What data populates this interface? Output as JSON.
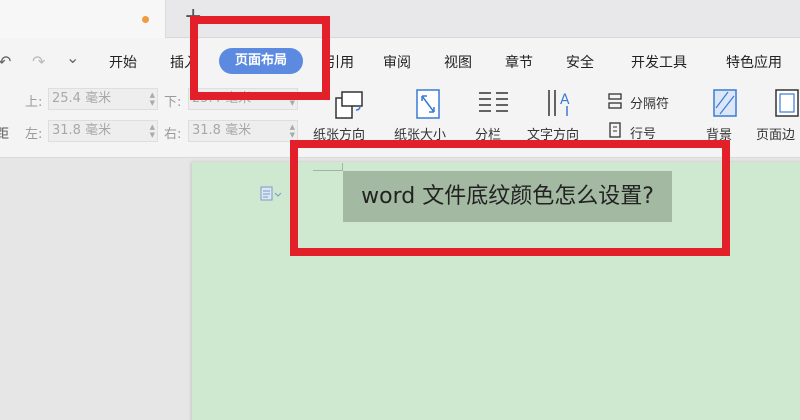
{
  "tabs": {
    "new_tab_label": "+"
  },
  "quick_access": {
    "undo_glyph": "↶",
    "redo_glyph": "↷",
    "more_glyph": "⌄"
  },
  "menu": {
    "items": [
      "开始",
      "插入",
      "页面布局",
      "引用",
      "审阅",
      "视图",
      "章节",
      "安全",
      "开发工具",
      "特色应用"
    ],
    "active": "页面布局"
  },
  "margins": {
    "top_label": "上:",
    "top_value": "25.4 毫米",
    "bottom_label": "下:",
    "bottom_value": "25.4 毫米",
    "left_label": "左:",
    "left_value": "31.8 毫米",
    "right_label": "右:",
    "right_value": "31.8 毫米",
    "prev_group_label": "距"
  },
  "tools": {
    "orientation": "纸张方向",
    "size": "纸张大小",
    "columns": "分栏",
    "text_direction": "文字方向",
    "separator": "分隔符",
    "line_numbers": "行号",
    "background": "背景",
    "page_border": "页面边"
  },
  "document": {
    "text": "word 文件底纹颜色怎么设置?"
  },
  "colors": {
    "highlight": "#e3202a",
    "active_tab": "#5b8ae0",
    "page_background": "#cfe8d0",
    "text_shading": "#a3b9a2"
  }
}
